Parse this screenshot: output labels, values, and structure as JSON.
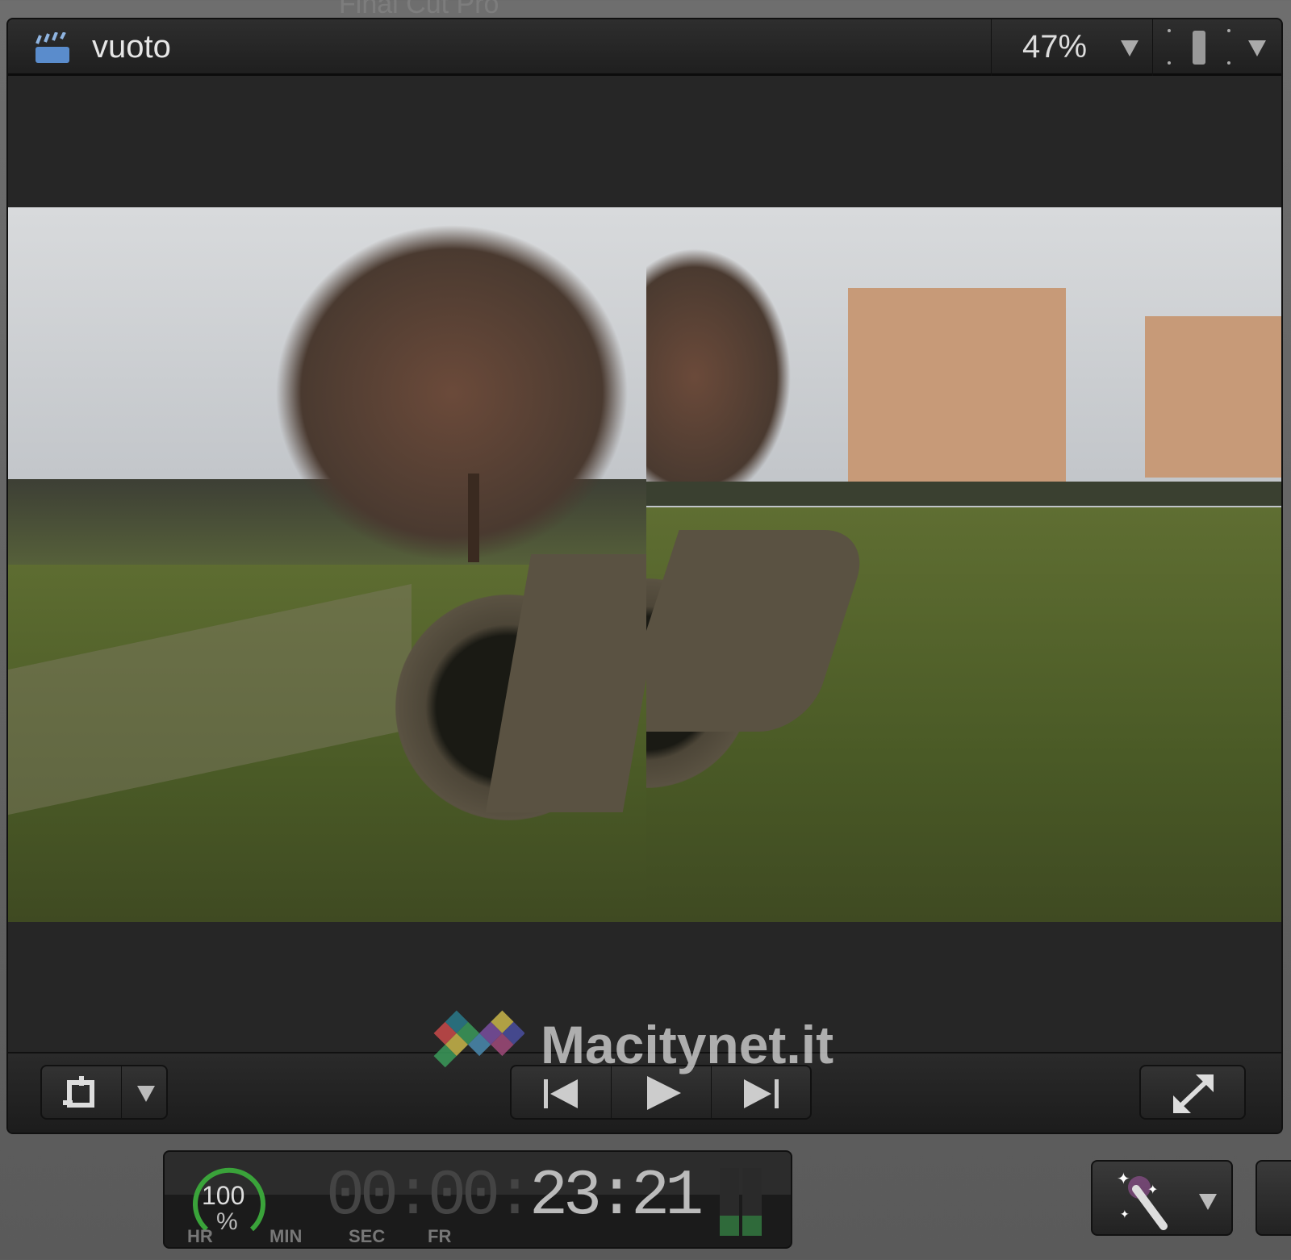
{
  "app_title": "Final Cut Pro",
  "viewer": {
    "clip_name": "vuoto",
    "zoom": "47%"
  },
  "timecode": {
    "dim_part": "00:00:",
    "value": "23:21",
    "speed": "100",
    "speed_unit": "%",
    "labels": [
      "HR",
      "MIN",
      "SEC",
      "FR"
    ]
  },
  "watermark": "Macitynet.it",
  "colors": {
    "speed_ring": "#3aa33a",
    "clapper": "#5a8ccc"
  }
}
